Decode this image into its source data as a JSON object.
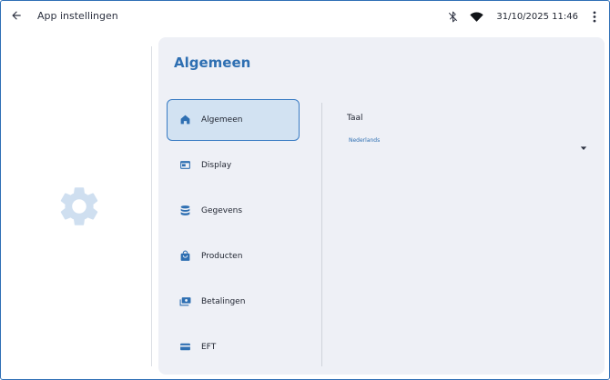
{
  "header": {
    "title": "App instellingen",
    "datetime": "31/10/2025  11:46",
    "icons": [
      "arrow-back-icon",
      "bluetooth-off-icon",
      "wifi-icon",
      "more-vert-icon"
    ]
  },
  "panel": {
    "title": "Algemeen"
  },
  "nav": {
    "items": [
      {
        "label": "Algemeen",
        "icon": "home-icon",
        "active": true
      },
      {
        "label": "Display",
        "icon": "display-icon",
        "active": false
      },
      {
        "label": "Gegevens",
        "icon": "database-icon",
        "active": false
      },
      {
        "label": "Producten",
        "icon": "shopping-bag-icon",
        "active": false
      },
      {
        "label": "Betalingen",
        "icon": "payments-icon",
        "active": false
      },
      {
        "label": "EFT",
        "icon": "card-icon",
        "active": false
      }
    ]
  },
  "settings": {
    "language_label": "Taal",
    "language_value": "Nederlands"
  },
  "colors": {
    "accent": "#2e6fb2",
    "panel_bg": "#eef0f6",
    "active_bg": "#d2e2f2",
    "gear": "#cfdff0"
  }
}
